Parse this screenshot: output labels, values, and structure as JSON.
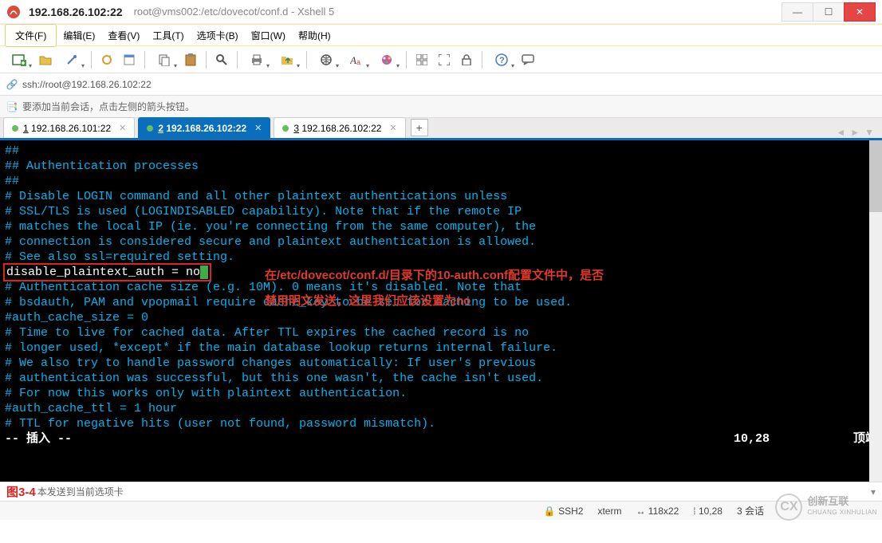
{
  "window": {
    "ip_title": "192.168.26.102:22",
    "path_title": "root@vms002:/etc/dovecot/conf.d - Xshell 5"
  },
  "menu": {
    "file": "文件(F)",
    "edit": "编辑(E)",
    "view": "查看(V)",
    "tools": "工具(T)",
    "tabs": "选项卡(B)",
    "window": "窗口(W)",
    "help": "帮助(H)"
  },
  "address": {
    "url": "ssh://root@192.168.26.102:22"
  },
  "infobar": {
    "text": "要添加当前会话，点击左侧的箭头按钮。"
  },
  "tabs": {
    "t1_num": "1",
    "t1_label": " 192.168.26.101:22",
    "t2_num": "2",
    "t2_label": " 192.168.26.102:22",
    "t3_num": "3",
    "t3_label": " 192.168.26.102:22"
  },
  "term": {
    "l1": "##",
    "l2": "## Authentication processes",
    "l3": "##",
    "l4": "",
    "l5": "# Disable LOGIN command and all other plaintext authentications unless",
    "l6": "# SSL/TLS is used (LOGINDISABLED capability). Note that if the remote IP",
    "l7": "# matches the local IP (ie. you're connecting from the same computer), the",
    "l8": "# connection is considered secure and plaintext authentication is allowed.",
    "l9": "# See also ssl=required setting.",
    "l10": "disable_plaintext_auth = no",
    "l11": "",
    "l12": "# Authentication cache size (e.g. 10M). 0 means it's disabled. Note that",
    "l13": "# bsdauth, PAM and vpopmail require cache_key to be set for caching to be used.",
    "l14": "#auth_cache_size = 0",
    "l15": "# Time to live for cached data. After TTL expires the cached record is no",
    "l16": "# longer used, *except* if the main database lookup returns internal failure.",
    "l17": "# We also try to handle password changes automatically: If user's previous",
    "l18": "# authentication was successful, but this one wasn't, the cache isn't used.",
    "l19": "# For now this works only with plaintext authentication.",
    "l20": "#auth_cache_ttl = 1 hour",
    "l21": "# TTL for negative hits (user not found, password mismatch).",
    "status_mode": "-- 插入 --",
    "status_pos": "10,28",
    "status_top": "顶端",
    "annot1": "在/etc/dovecot/conf.d/目录下的10-auth.conf配置文件中，是否",
    "annot2": "禁用明文发送，这里我们应该设置为no"
  },
  "bottom": {
    "hint": "本发送到当前选项卡",
    "figlabel": "图3-4"
  },
  "status": {
    "ssh": "SSH2",
    "term": "xterm",
    "size": "118x22",
    "pos": "10,28",
    "sess": "3 会话"
  },
  "watermark": {
    "cn": "创新互联",
    "en": "CHUANG XINHULIAN"
  }
}
